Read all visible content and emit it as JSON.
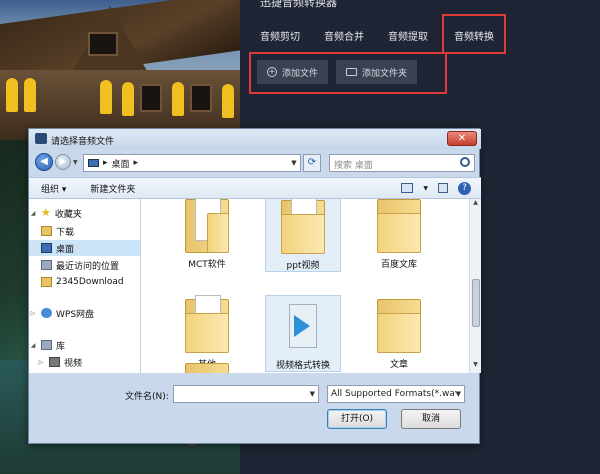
{
  "app": {
    "title": "迅捷音频转换器",
    "tabs": [
      {
        "label": "音频剪切"
      },
      {
        "label": "音频合并"
      },
      {
        "label": "音频提取"
      },
      {
        "label": "音频转换"
      }
    ],
    "toolbar": {
      "add_file_label": "添加文件",
      "add_folder_label": "添加文件夹"
    }
  },
  "dialog": {
    "title": "请选择音频文件",
    "close_label": "✕",
    "address": "桌面",
    "search_placeholder": "搜索 桌面",
    "command_bar": {
      "organize_label": "组织 ▾",
      "new_folder_label": "新建文件夹"
    },
    "nav": [
      {
        "label": "收藏夹",
        "icon": "star-icon"
      },
      {
        "label": "下载",
        "icon": "folder-icon"
      },
      {
        "label": "桌面",
        "icon": "desktop-icon"
      },
      {
        "label": "最近访问的位置",
        "icon": "recent-icon"
      },
      {
        "label": "2345Download",
        "icon": "folder-icon"
      },
      {
        "label": "WPS网盘",
        "icon": "cloud-icon"
      },
      {
        "label": "库",
        "icon": "library-icon"
      },
      {
        "label": "视频",
        "icon": "video-library-icon"
      }
    ],
    "files": [
      {
        "name": "MCT软件"
      },
      {
        "name": "ppt视频"
      },
      {
        "name": "百度文库"
      },
      {
        "name": "其他"
      },
      {
        "name": "视频格式转换"
      },
      {
        "name": "文章"
      }
    ],
    "filename_label": "文件名(N):",
    "filename_value": "",
    "filter_value": "All Supported Formats(*.wav",
    "open_label": "打开(O)",
    "cancel_label": "取消"
  }
}
